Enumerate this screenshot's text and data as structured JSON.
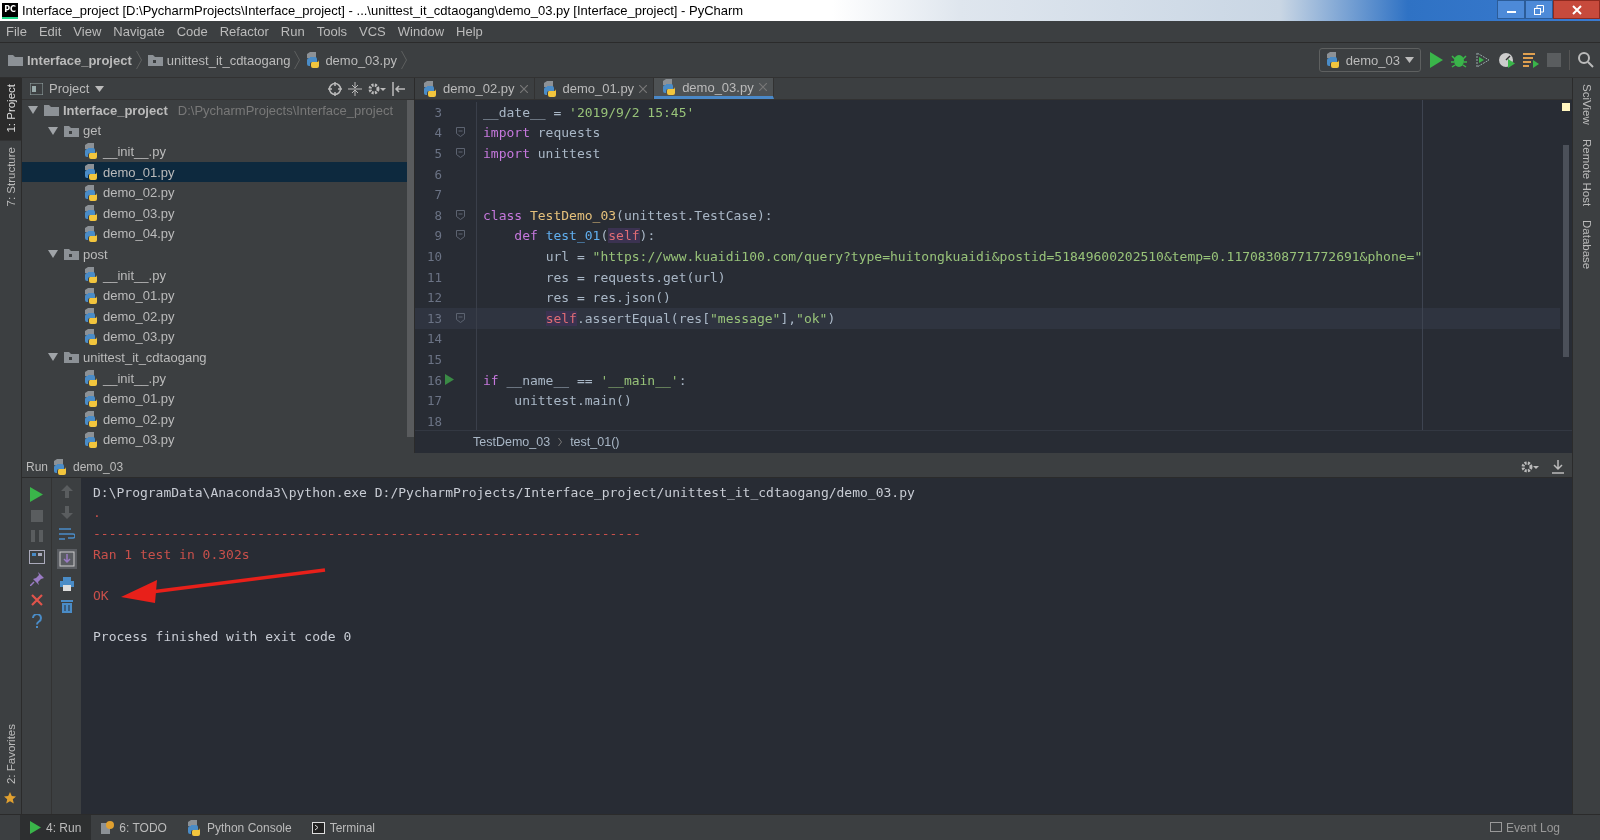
{
  "window": {
    "title": "Interface_project [D:\\PycharmProjects\\Interface_project] - ...\\unittest_it_cdtaogang\\demo_03.py [Interface_project] - PyCharm",
    "app_badge": "PC"
  },
  "menu": [
    "File",
    "Edit",
    "View",
    "Navigate",
    "Code",
    "Refactor",
    "Run",
    "Tools",
    "VCS",
    "Window",
    "Help"
  ],
  "breadcrumb": [
    {
      "label": "Interface_project",
      "kind": "project"
    },
    {
      "label": "unittest_it_cdtaogang",
      "kind": "folder"
    },
    {
      "label": "demo_03.py",
      "kind": "file"
    }
  ],
  "run_config": {
    "label": "demo_03"
  },
  "left_strip": {
    "top": [
      {
        "label": "1: Project",
        "selected": true
      },
      {
        "label": "7: Structure",
        "selected": false
      }
    ],
    "bottom": [
      {
        "label": "2: Favorites",
        "selected": false
      }
    ]
  },
  "right_strip": [
    {
      "label": "SciView"
    },
    {
      "label": "Remote Host"
    },
    {
      "label": "Database"
    }
  ],
  "project_panel": {
    "title": "Project",
    "tree": [
      {
        "label": "Interface_project",
        "path": "D:\\PycharmProjects\\Interface_project",
        "kind": "root",
        "expanded": true,
        "selected": false,
        "children": [
          {
            "label": "get",
            "kind": "folder",
            "expanded": true,
            "selected": false,
            "children": [
              {
                "label": "__init__.py",
                "kind": "file",
                "selected": false
              },
              {
                "label": "demo_01.py",
                "kind": "file",
                "selected": true
              },
              {
                "label": "demo_02.py",
                "kind": "file",
                "selected": false
              },
              {
                "label": "demo_03.py",
                "kind": "file",
                "selected": false
              },
              {
                "label": "demo_04.py",
                "kind": "file",
                "selected": false
              }
            ]
          },
          {
            "label": "post",
            "kind": "folder",
            "expanded": true,
            "selected": false,
            "children": [
              {
                "label": "__init__.py",
                "kind": "file",
                "selected": false
              },
              {
                "label": "demo_01.py",
                "kind": "file",
                "selected": false
              },
              {
                "label": "demo_02.py",
                "kind": "file",
                "selected": false
              },
              {
                "label": "demo_03.py",
                "kind": "file",
                "selected": false
              }
            ]
          },
          {
            "label": "unittest_it_cdtaogang",
            "kind": "folder",
            "expanded": true,
            "selected": false,
            "children": [
              {
                "label": "__init__.py",
                "kind": "file",
                "selected": false
              },
              {
                "label": "demo_01.py",
                "kind": "file",
                "selected": false
              },
              {
                "label": "demo_02.py",
                "kind": "file",
                "selected": false
              },
              {
                "label": "demo_03.py",
                "kind": "file",
                "selected": false
              }
            ]
          }
        ]
      }
    ]
  },
  "editor": {
    "tabs": [
      {
        "label": "demo_02.py",
        "selected": false
      },
      {
        "label": "demo_01.py",
        "selected": false
      },
      {
        "label": "demo_03.py",
        "selected": true
      }
    ],
    "lines": [
      {
        "number": "3",
        "current": false,
        "fold": false,
        "runnable": false,
        "tokens": [
          {
            "text": "__date__ = ",
            "kind": "plain"
          },
          {
            "text": "'2019/9/2 15:45'",
            "kind": "string"
          }
        ]
      },
      {
        "number": "4",
        "current": false,
        "fold": true,
        "runnable": false,
        "tokens": [
          {
            "text": "import",
            "kind": "keyword"
          },
          {
            "text": " requests",
            "kind": "plain"
          }
        ]
      },
      {
        "number": "5",
        "current": false,
        "fold": true,
        "runnable": false,
        "tokens": [
          {
            "text": "import",
            "kind": "keyword"
          },
          {
            "text": " unittest",
            "kind": "plain"
          }
        ]
      },
      {
        "number": "6",
        "current": false,
        "fold": false,
        "runnable": false
      },
      {
        "number": "7",
        "current": false,
        "fold": false,
        "runnable": false
      },
      {
        "number": "8",
        "current": false,
        "fold": true,
        "runnable": false,
        "tokens": [
          {
            "text": "class",
            "kind": "keyword"
          },
          {
            "text": " TestDemo_03",
            "kind": "classname"
          },
          {
            "text": "(unittest.TestCase):",
            "kind": "plain"
          }
        ]
      },
      {
        "number": "9",
        "current": false,
        "fold": true,
        "runnable": false,
        "tokens": [
          {
            "text": "    def",
            "kind": "keyword"
          },
          {
            "text": " test_01",
            "kind": "funcname"
          },
          {
            "text": "(",
            "kind": "plain"
          },
          {
            "text": "self",
            "kind": "self"
          },
          {
            "text": "):",
            "kind": "plain"
          }
        ]
      },
      {
        "number": "10",
        "current": false,
        "fold": false,
        "runnable": false,
        "tokens": [
          {
            "text": "        url = ",
            "kind": "plain"
          },
          {
            "text": "\"https://www.kuaidi100.com/query?type=huitongkuaidi&postid=51849600202510&temp=0.11708308771772691&phone=\"",
            "kind": "string"
          }
        ]
      },
      {
        "number": "11",
        "current": false,
        "fold": false,
        "runnable": false,
        "tokens": [
          {
            "text": "        res = requests.get(url)",
            "kind": "plain"
          }
        ]
      },
      {
        "number": "12",
        "current": false,
        "fold": false,
        "runnable": false,
        "tokens": [
          {
            "text": "        res = res.json()",
            "kind": "plain"
          }
        ]
      },
      {
        "number": "13",
        "current": true,
        "fold": true,
        "runnable": false,
        "tokens": [
          {
            "text": "        self",
            "kind": "self"
          },
          {
            "text": ".assertEqual(res[",
            "kind": "plain"
          },
          {
            "text": "\"message\"",
            "kind": "string"
          },
          {
            "text": "],",
            "kind": "plain"
          },
          {
            "text": "\"ok\"",
            "kind": "string"
          },
          {
            "text": ")",
            "kind": "plain"
          }
        ]
      },
      {
        "number": "14",
        "current": false,
        "fold": false,
        "runnable": false
      },
      {
        "number": "15",
        "current": false,
        "fold": false,
        "runnable": false
      },
      {
        "number": "16",
        "current": false,
        "fold": false,
        "runnable": true,
        "tokens": [
          {
            "text": "if",
            "kind": "keyword"
          },
          {
            "text": " __name__ == ",
            "kind": "plain"
          },
          {
            "text": "'__main__'",
            "kind": "string"
          },
          {
            "text": ":",
            "kind": "plain"
          }
        ]
      },
      {
        "number": "17",
        "current": false,
        "fold": false,
        "runnable": false,
        "tokens": [
          {
            "text": "    unittest.main()",
            "kind": "plain"
          }
        ]
      },
      {
        "number": "18",
        "current": false,
        "fold": false,
        "runnable": false
      }
    ],
    "breadcrumb": [
      "TestDemo_03",
      "test_01()"
    ]
  },
  "run_panel": {
    "title": "Run",
    "config": "demo_03",
    "output": [
      {
        "text": "D:\\ProgramData\\Anaconda3\\python.exe D:/PycharmProjects/Interface_project/unittest_it_cdtaogang/demo_03.py",
        "kind": "stdout"
      },
      {
        "text": ".",
        "kind": "stderr"
      },
      {
        "text": "----------------------------------------------------------------------",
        "kind": "stderr"
      },
      {
        "text": "Ran 1 test in 0.302s",
        "kind": "stderr"
      },
      {
        "kind": "blank"
      },
      {
        "text": "OK",
        "kind": "stderr"
      },
      {
        "kind": "blank"
      },
      {
        "text": "Process finished with exit code 0",
        "kind": "stdout"
      }
    ]
  },
  "status_bar": {
    "tools": [
      {
        "label": "4: Run",
        "kind": "run",
        "selected": true
      },
      {
        "label": "6: TODO",
        "kind": "todo",
        "selected": false
      },
      {
        "label": "Python Console",
        "kind": "console",
        "selected": false
      },
      {
        "label": "Terminal",
        "kind": "terminal",
        "selected": false
      }
    ],
    "event_log": "Event Log"
  }
}
